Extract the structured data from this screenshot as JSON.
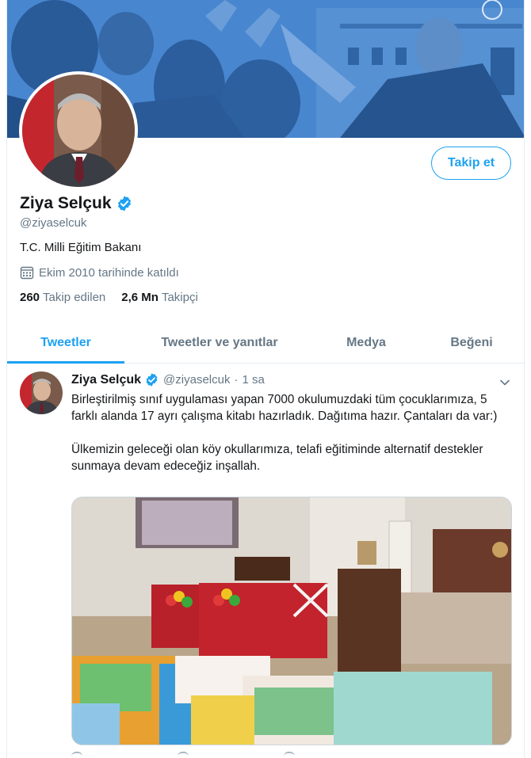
{
  "profile": {
    "display_name": "Ziya Selçuk",
    "handle": "@ziyaselcuk",
    "bio": "T.C. Milli Eğitim Bakanı",
    "joined": "Ekim 2010 tarihinde katıldı",
    "following_count": "260",
    "following_label": "Takip edilen",
    "followers_count": "2,6 Mn",
    "followers_label": "Takipçi",
    "follow_label": "Takip et",
    "verified_icon": "verified-badge-icon",
    "calendar_icon": "calendar-icon"
  },
  "tabs": [
    {
      "label": "Tweetler",
      "active": true
    },
    {
      "label": "Tweetler ve yanıtlar",
      "active": false
    },
    {
      "label": "Medya",
      "active": false
    },
    {
      "label": "Beğeni",
      "active": false
    }
  ],
  "tweet": {
    "author": "Ziya Selçuk",
    "handle": "@ziyaselcuk",
    "separator": "·",
    "time": "1 sa",
    "paragraph1": "Birleştirilmiş sınıf uygulaması yapan 7000 okulumuzdaki tüm çocuklarımıza, 5 farklı alanda 17 ayrı çalışma kitabı hazırladık. Dağıtıma hazır. Çantaları da var:)",
    "paragraph2": "Ülkemizin geleceği olan köy okullarımıza, telafi eğitiminde alternatif destekler sunmaya devam edeceğiz inşallah."
  },
  "colors": {
    "accent": "#1da1f2",
    "secondary_text": "#657786",
    "banner": "#3f7fc6"
  }
}
